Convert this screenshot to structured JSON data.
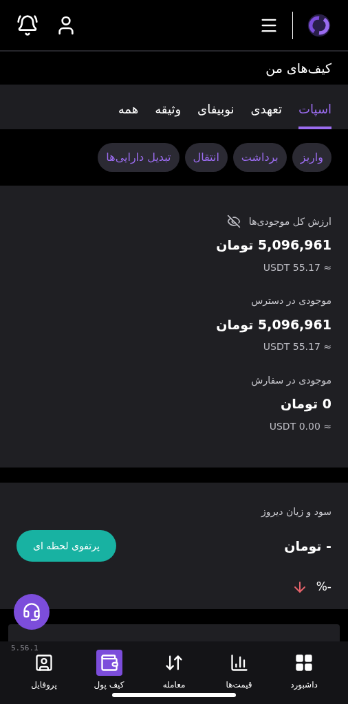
{
  "header": {
    "title": "کیف‌های من"
  },
  "tabs": [
    {
      "label": "اسپات",
      "selected": true
    },
    {
      "label": "تعهدی",
      "selected": false
    },
    {
      "label": "نوبیفای",
      "selected": false
    },
    {
      "label": "وثیقه",
      "selected": false
    },
    {
      "label": "همه",
      "selected": false
    }
  ],
  "actions": [
    "واریز",
    "برداشت",
    "انتقال",
    "تبدیل دارایی‌ها"
  ],
  "balances": [
    {
      "label": "ارزش کل موجودی‌ها",
      "value": "5,096,961 تومان",
      "usdt": "USDT 55.17 ≈",
      "hidden_toggle": true
    },
    {
      "label": "موجودی در دسترس",
      "value": "5,096,961 تومان",
      "usdt": "USDT 55.17 ≈"
    },
    {
      "label": "موجودی در سفارش",
      "value": "0 تومان",
      "usdt": "USDT 0.00 ≈"
    }
  ],
  "pnl": {
    "label": "سود و زیان دیروز",
    "value": "- تومان",
    "change": {
      "kind": "down",
      "text": "-%"
    },
    "button": "پرتفوی لحظه ای"
  },
  "version": "5.56.1",
  "nav": [
    {
      "label": "داشبورد",
      "kind": "dashboard",
      "selected": false
    },
    {
      "label": "قیمت‌ها",
      "kind": "prices",
      "selected": false
    },
    {
      "label": "معامله",
      "kind": "trade",
      "selected": false
    },
    {
      "label": "کیف پول",
      "kind": "wallet",
      "selected": true
    },
    {
      "label": "پروفایل",
      "kind": "profile",
      "selected": false
    }
  ]
}
